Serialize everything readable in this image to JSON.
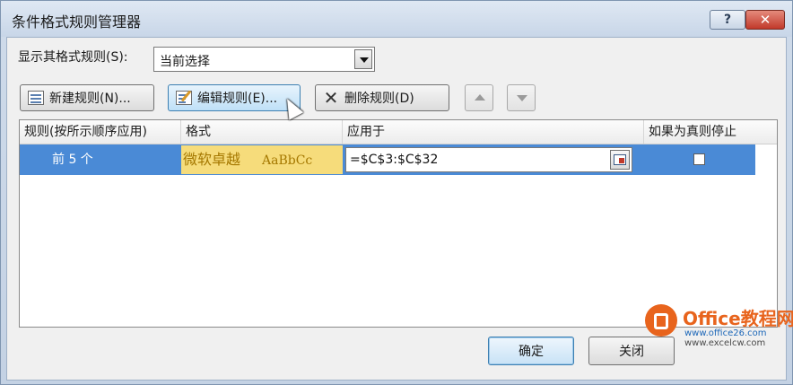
{
  "window": {
    "title": "条件格式规则管理器",
    "help_label": "?",
    "close_label": "✕"
  },
  "show_rules": {
    "label": "显示其格式规则(S):",
    "value": "当前选择"
  },
  "toolbar": {
    "new_label": "新建规则(N)...",
    "edit_label": "编辑规则(E)...",
    "delete_label": "删除规则(D)"
  },
  "columns": [
    "规则(按所示顺序应用)",
    "格式",
    "应用于",
    "如果为真则停止"
  ],
  "rules": [
    {
      "rule": "前 5 个",
      "format_preview": "微软卓越",
      "format_sample": "AaBbCc",
      "applies_to": "=$C$3:$C$32",
      "stop_if_true": false
    }
  ],
  "footer": {
    "ok_label": "确定",
    "close_label": "关闭"
  },
  "watermark": {
    "name": "Office教程网",
    "url1": "www.office26.com",
    "url2": "www.excelcw.com"
  },
  "colors": {
    "selection": "#4a8ad6",
    "preview_fill": "#f6dc7b",
    "preview_text": "#a57800",
    "watermark": "#e8641d"
  }
}
